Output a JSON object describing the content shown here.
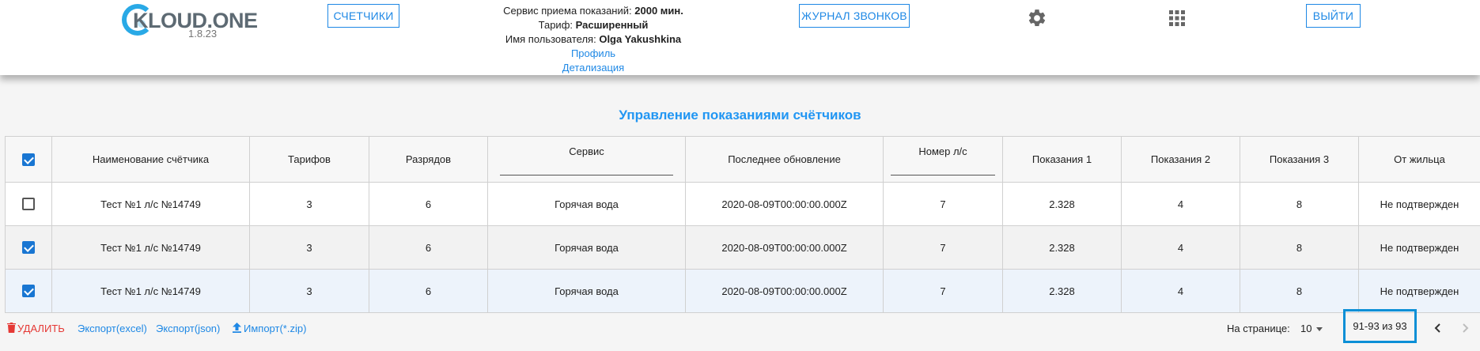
{
  "header": {
    "logo_text": "KLOUD.ONE",
    "version": "1.8.23",
    "meters_button": "СЧЕТЧИКИ",
    "calls_log_button": "ЖУРНАЛ ЗВОНКОВ",
    "exit_button": "ВЫЙТИ",
    "service_label": "Сервис приема показаний: ",
    "service_value": "2000 мин.",
    "tariff_label": "Тариф: ",
    "tariff_value": "Расширенный",
    "user_label": "Имя пользователя: ",
    "user_value": "Olga Yakushkina",
    "profile_link": "Профиль",
    "details_link": "Детализация",
    "settings_icon": "gear-icon",
    "apps_icon": "apps-grid-icon"
  },
  "page_title": "Управление показаниями счётчиков",
  "table": {
    "columns": [
      "Наименование счётчика",
      "Тарифов",
      "Разрядов",
      "Сервис",
      "Последнее обновление",
      "Номер л/с",
      "Показания 1",
      "Показания 2",
      "Показания 3",
      "От жильца"
    ],
    "header_checked": true,
    "rows": [
      {
        "checked": false,
        "cells": [
          "Тест №1 л/с №14749",
          "3",
          "6",
          "Горячая вода",
          "2020-08-09T00:00:00.000Z",
          "7",
          "2.328",
          "4",
          "8",
          "Не подтвержден"
        ]
      },
      {
        "checked": true,
        "cells": [
          "Тест №1 л/с №14749",
          "3",
          "6",
          "Горячая вода",
          "2020-08-09T00:00:00.000Z",
          "7",
          "2.328",
          "4",
          "8",
          "Не подтвержден"
        ]
      },
      {
        "checked": true,
        "cells": [
          "Тест №1 л/с №14749",
          "3",
          "6",
          "Горячая вода",
          "2020-08-09T00:00:00.000Z",
          "7",
          "2.328",
          "4",
          "8",
          "Не подтвержден"
        ]
      }
    ]
  },
  "footer": {
    "delete_label": "УДАЛИТЬ",
    "export_excel": "Экспорт(excel)",
    "export_json": "Экспорт(json)",
    "import_label": "Импорт(*.zip)",
    "per_page_label": "На странице:",
    "per_page_value": "10",
    "range": "91-93 из 93"
  },
  "colors": {
    "accent": "#1e88e5",
    "title": "#2196f3",
    "danger": "#e53935",
    "highlight_box": "#0b8fd6"
  }
}
